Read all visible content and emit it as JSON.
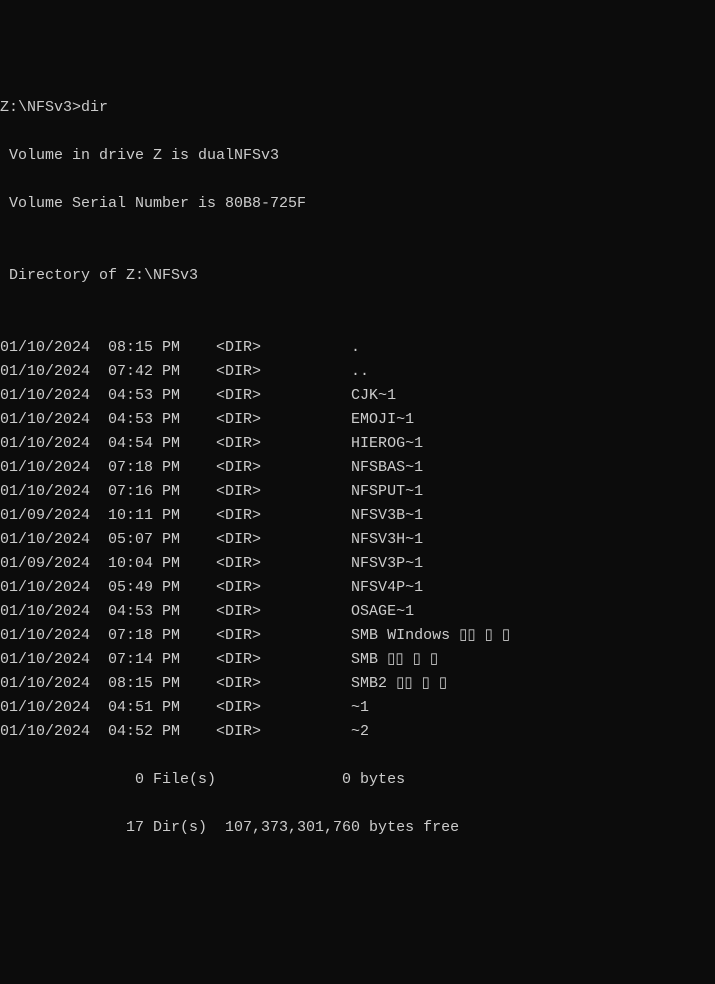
{
  "prompt": "Z:\\NFSv3>dir",
  "volume_line": " Volume in drive Z is dualNFSv3",
  "serial_line": " Volume Serial Number is 80B8-725F",
  "blank1": "",
  "directory_of": " Directory of Z:\\NFSv3",
  "blank2": "",
  "entries": [
    {
      "date": "01/10/2024",
      "time": "08:15 PM",
      "type": "<DIR>",
      "name": "."
    },
    {
      "date": "01/10/2024",
      "time": "07:42 PM",
      "type": "<DIR>",
      "name": ".."
    },
    {
      "date": "01/10/2024",
      "time": "04:53 PM",
      "type": "<DIR>",
      "name": "CJK~1"
    },
    {
      "date": "01/10/2024",
      "time": "04:53 PM",
      "type": "<DIR>",
      "name": "EMOJI~1"
    },
    {
      "date": "01/10/2024",
      "time": "04:54 PM",
      "type": "<DIR>",
      "name": "HIEROG~1"
    },
    {
      "date": "01/10/2024",
      "time": "07:18 PM",
      "type": "<DIR>",
      "name": "NFSBAS~1"
    },
    {
      "date": "01/10/2024",
      "time": "07:16 PM",
      "type": "<DIR>",
      "name": "NFSPUT~1"
    },
    {
      "date": "01/09/2024",
      "time": "10:11 PM",
      "type": "<DIR>",
      "name": "NFSV3B~1"
    },
    {
      "date": "01/10/2024",
      "time": "05:07 PM",
      "type": "<DIR>",
      "name": "NFSV3H~1"
    },
    {
      "date": "01/09/2024",
      "time": "10:04 PM",
      "type": "<DIR>",
      "name": "NFSV3P~1"
    },
    {
      "date": "01/10/2024",
      "time": "05:49 PM",
      "type": "<DIR>",
      "name": "NFSV4P~1"
    },
    {
      "date": "01/10/2024",
      "time": "04:53 PM",
      "type": "<DIR>",
      "name": "OSAGE~1"
    },
    {
      "date": "01/10/2024",
      "time": "07:18 PM",
      "type": "<DIR>",
      "name": "SMB WIndows ▯▯ ▯ ▯"
    },
    {
      "date": "01/10/2024",
      "time": "07:14 PM",
      "type": "<DIR>",
      "name": "SMB ▯▯ ▯ ▯"
    },
    {
      "date": "01/10/2024",
      "time": "08:15 PM",
      "type": "<DIR>",
      "name": "SMB2 ▯▯ ▯ ▯"
    },
    {
      "date": "01/10/2024",
      "time": "04:51 PM",
      "type": "<DIR>",
      "name": "~1"
    },
    {
      "date": "01/10/2024",
      "time": "04:52 PM",
      "type": "<DIR>",
      "name": "~2"
    }
  ],
  "files_summary": "               0 File(s)              0 bytes",
  "dirs_summary": "              17 Dir(s)  107,373,301,760 bytes free"
}
